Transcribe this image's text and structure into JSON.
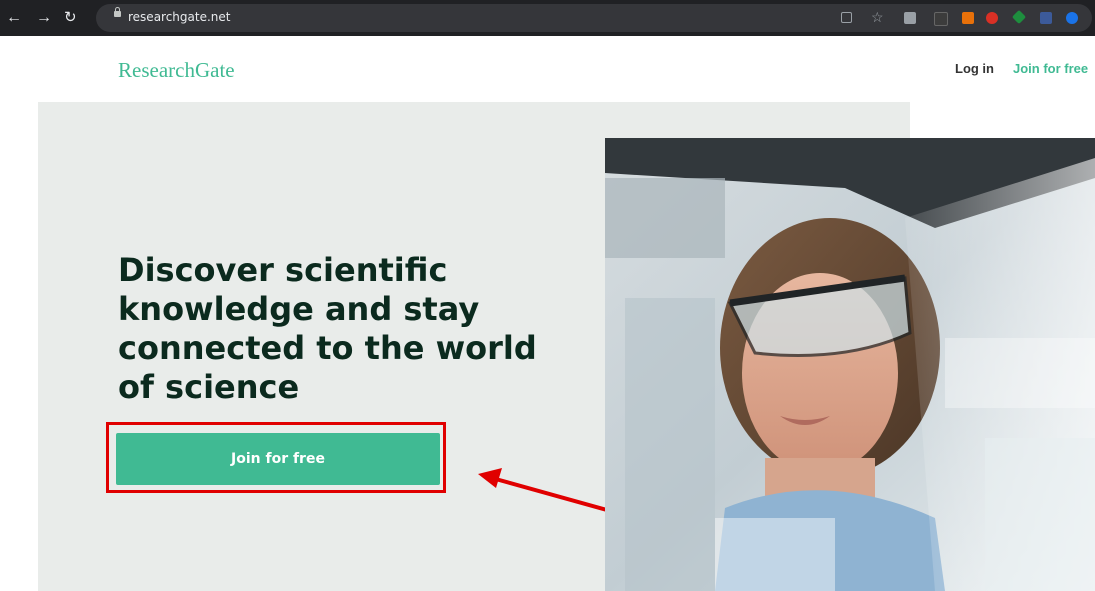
{
  "browser": {
    "url": "researchgate.net",
    "icons": [
      "back-arrow-icon",
      "forward-arrow-icon",
      "reload-icon",
      "lock-icon",
      "share-icon",
      "star-icon",
      "extension-icons"
    ]
  },
  "header": {
    "logo": "ResearchGate",
    "login_label": "Log in",
    "join_label": "Join for free"
  },
  "hero": {
    "headline": "Discover scientific knowledge and stay connected to the world of science",
    "cta_label": "Join for free"
  },
  "colors": {
    "brand": "#40ba93",
    "hero_bg": "#e9ecea",
    "headline": "#0b2a1e",
    "annotation": "#e00000"
  }
}
